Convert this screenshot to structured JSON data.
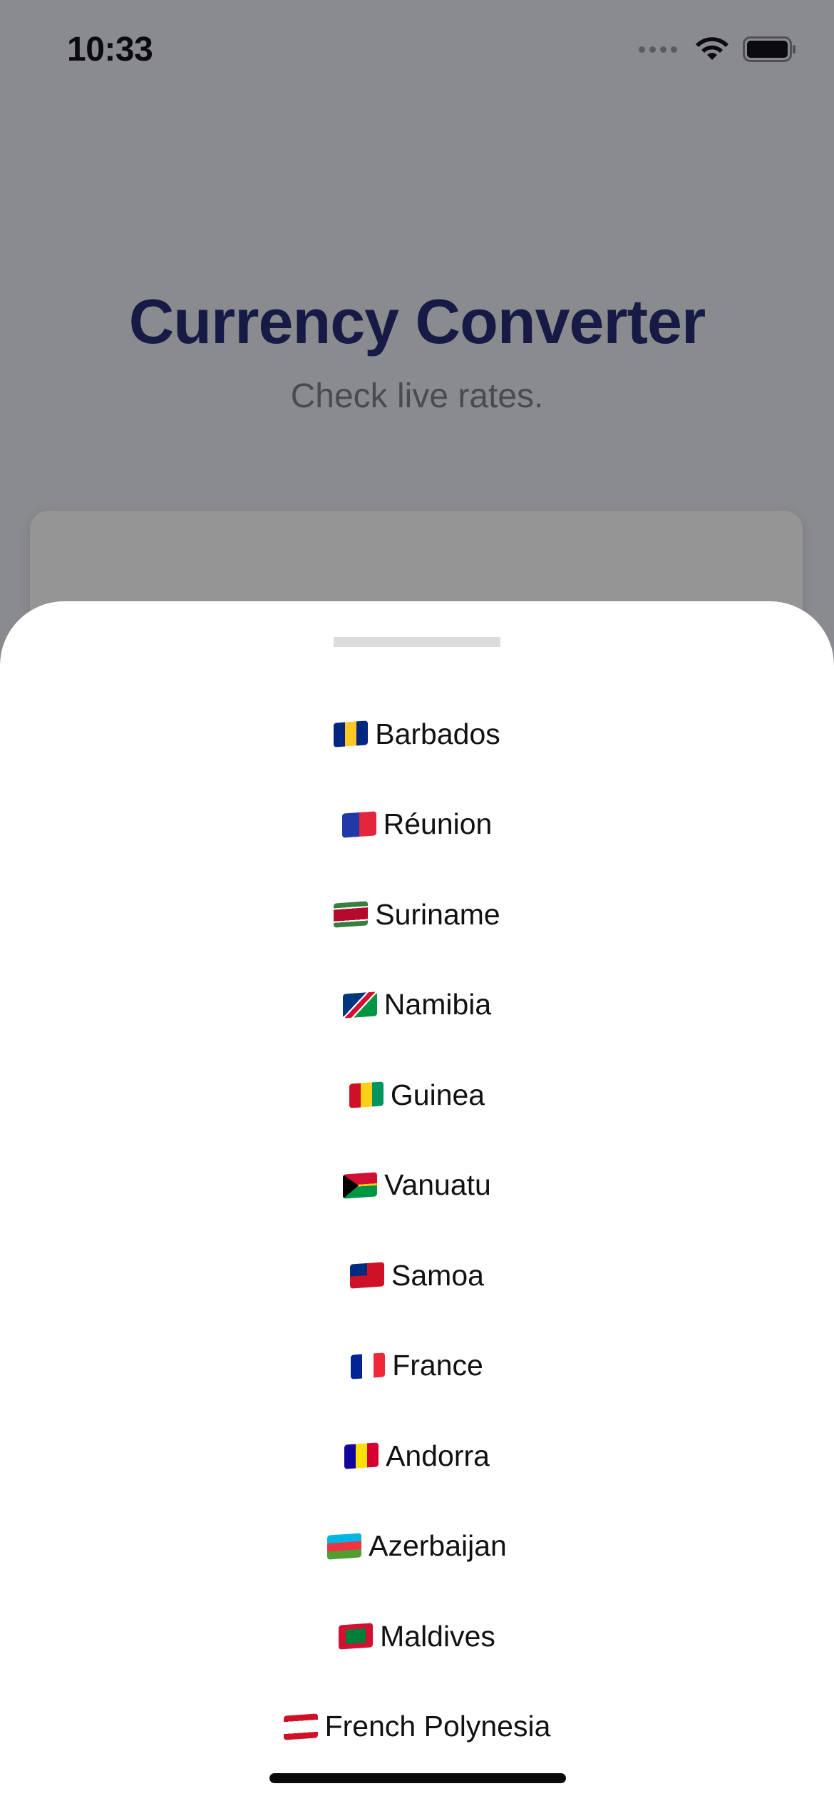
{
  "status_bar": {
    "time": "10:33",
    "icons": [
      "cellular-dots-icon",
      "wifi-icon",
      "battery-icon"
    ]
  },
  "background_screen": {
    "title": "Currency Converter",
    "subtitle": "Check live rates."
  },
  "sheet": {
    "countries": [
      {
        "flag": "flag-barbados",
        "name": "Barbados"
      },
      {
        "flag": "flag-reunion",
        "name": "Réunion"
      },
      {
        "flag": "flag-suriname",
        "name": "Suriname"
      },
      {
        "flag": "flag-namibia",
        "name": "Namibia"
      },
      {
        "flag": "flag-guinea",
        "name": "Guinea"
      },
      {
        "flag": "flag-vanuatu",
        "name": "Vanuatu"
      },
      {
        "flag": "flag-samoa",
        "name": "Samoa"
      },
      {
        "flag": "flag-france",
        "name": "France"
      },
      {
        "flag": "flag-andorra",
        "name": "Andorra"
      },
      {
        "flag": "flag-azerbaijan",
        "name": "Azerbaijan"
      },
      {
        "flag": "flag-maldives",
        "name": "Maldives"
      },
      {
        "flag": "flag-french-polynesia",
        "name": "French Polynesia"
      }
    ]
  },
  "colors": {
    "title": "#161a45",
    "overlay": "#8a8b8e",
    "sheet": "#ffffff"
  }
}
